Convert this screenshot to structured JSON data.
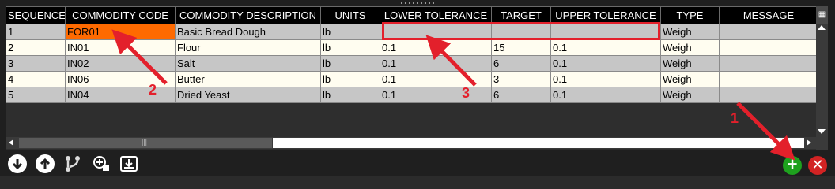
{
  "columns": [
    "SEQUENCE",
    "COMMODITY CODE",
    "COMMODITY DESCRIPTION",
    "UNITS",
    "LOWER TOLERANCE",
    "TARGET",
    "UPPER TOLERANCE",
    "TYPE",
    "MESSAGE"
  ],
  "rows": [
    [
      "1",
      "FOR01",
      "Basic Bread Dough",
      "lb",
      "",
      "",
      "",
      "Weigh",
      ""
    ],
    [
      "2",
      "IN01",
      "Flour",
      "lb",
      "0.1",
      "15",
      "0.1",
      "Weigh",
      ""
    ],
    [
      "3",
      "IN02",
      "Salt",
      "lb",
      "0.1",
      "6",
      "0.1",
      "Weigh",
      ""
    ],
    [
      "4",
      "IN06",
      "Butter",
      "lb",
      "0.1",
      "3",
      "0.1",
      "Weigh",
      ""
    ],
    [
      "5",
      "IN04",
      "Dried Yeast",
      "lb",
      "0.1",
      "6",
      "0.1",
      "Weigh",
      ""
    ]
  ],
  "annotations": {
    "one": "1",
    "two": "2",
    "three": "3"
  },
  "icons": {
    "move_down": "arrow-down-circle-icon",
    "move_up": "arrow-up-circle-icon",
    "branch": "branch-icon",
    "copy": "copy-add-icon",
    "import": "download-tray-icon",
    "add": "plus-circle-icon",
    "cancel": "close-circle-icon"
  },
  "colors": {
    "highlight": "#ff6a00",
    "annotation": "#e3202b",
    "add": "#1ea11e",
    "cancel": "#d22323"
  }
}
